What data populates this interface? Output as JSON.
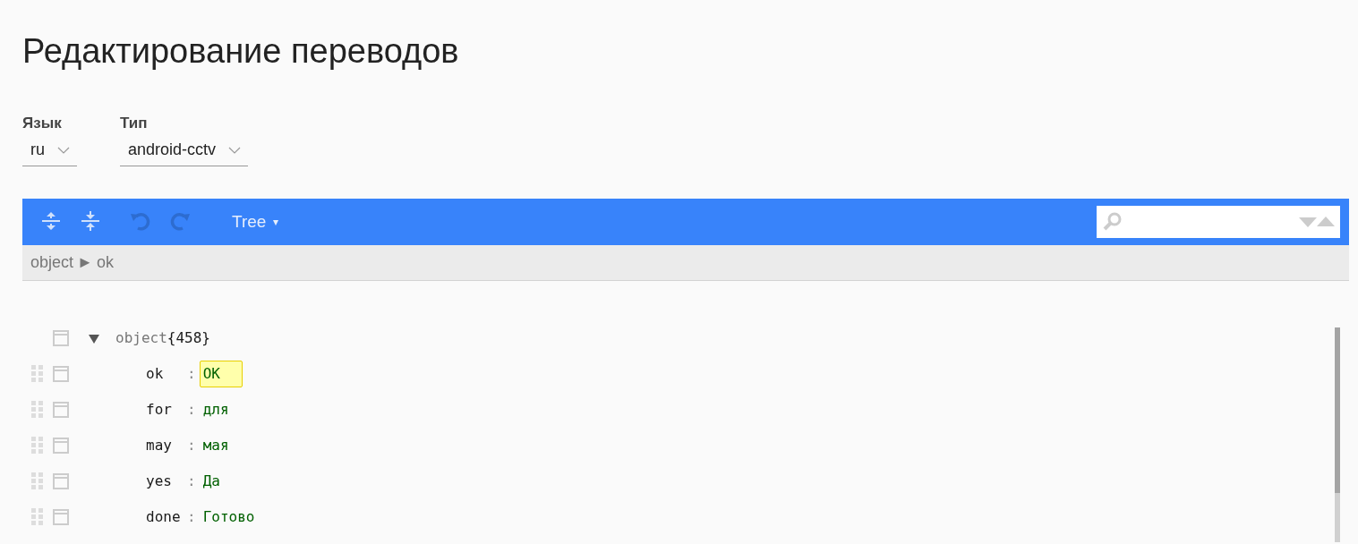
{
  "title": "Редактирование переводов",
  "filters": [
    {
      "label": "Язык",
      "value": "ru"
    },
    {
      "label": "Тип",
      "value": "android-cctv"
    }
  ],
  "toolbar": {
    "buttons": [
      {
        "kind": "expand",
        "disabled": false
      },
      {
        "kind": "collapse",
        "disabled": false
      },
      {
        "kind": "undo",
        "disabled": true
      },
      {
        "kind": "redo",
        "disabled": true
      }
    ],
    "mode": "Tree",
    "mode_caret": "▾"
  },
  "breadcrumb": {
    "items": [
      "object",
      "ok"
    ],
    "separator": "►"
  },
  "tree": {
    "key": "object",
    "count": "{458}",
    "expanded": true,
    "children": [
      {
        "key": "ok",
        "separator": ":",
        "value": "OK",
        "selected": true
      },
      {
        "key": "for",
        "separator": ":",
        "value": "для",
        "selected": false
      },
      {
        "key": "may",
        "separator": ":",
        "value": "мая",
        "selected": false
      },
      {
        "key": "yes",
        "separator": ":",
        "value": "Да",
        "selected": false
      },
      {
        "key": "done",
        "separator": ":",
        "value": "Готово",
        "selected": false
      }
    ]
  }
}
